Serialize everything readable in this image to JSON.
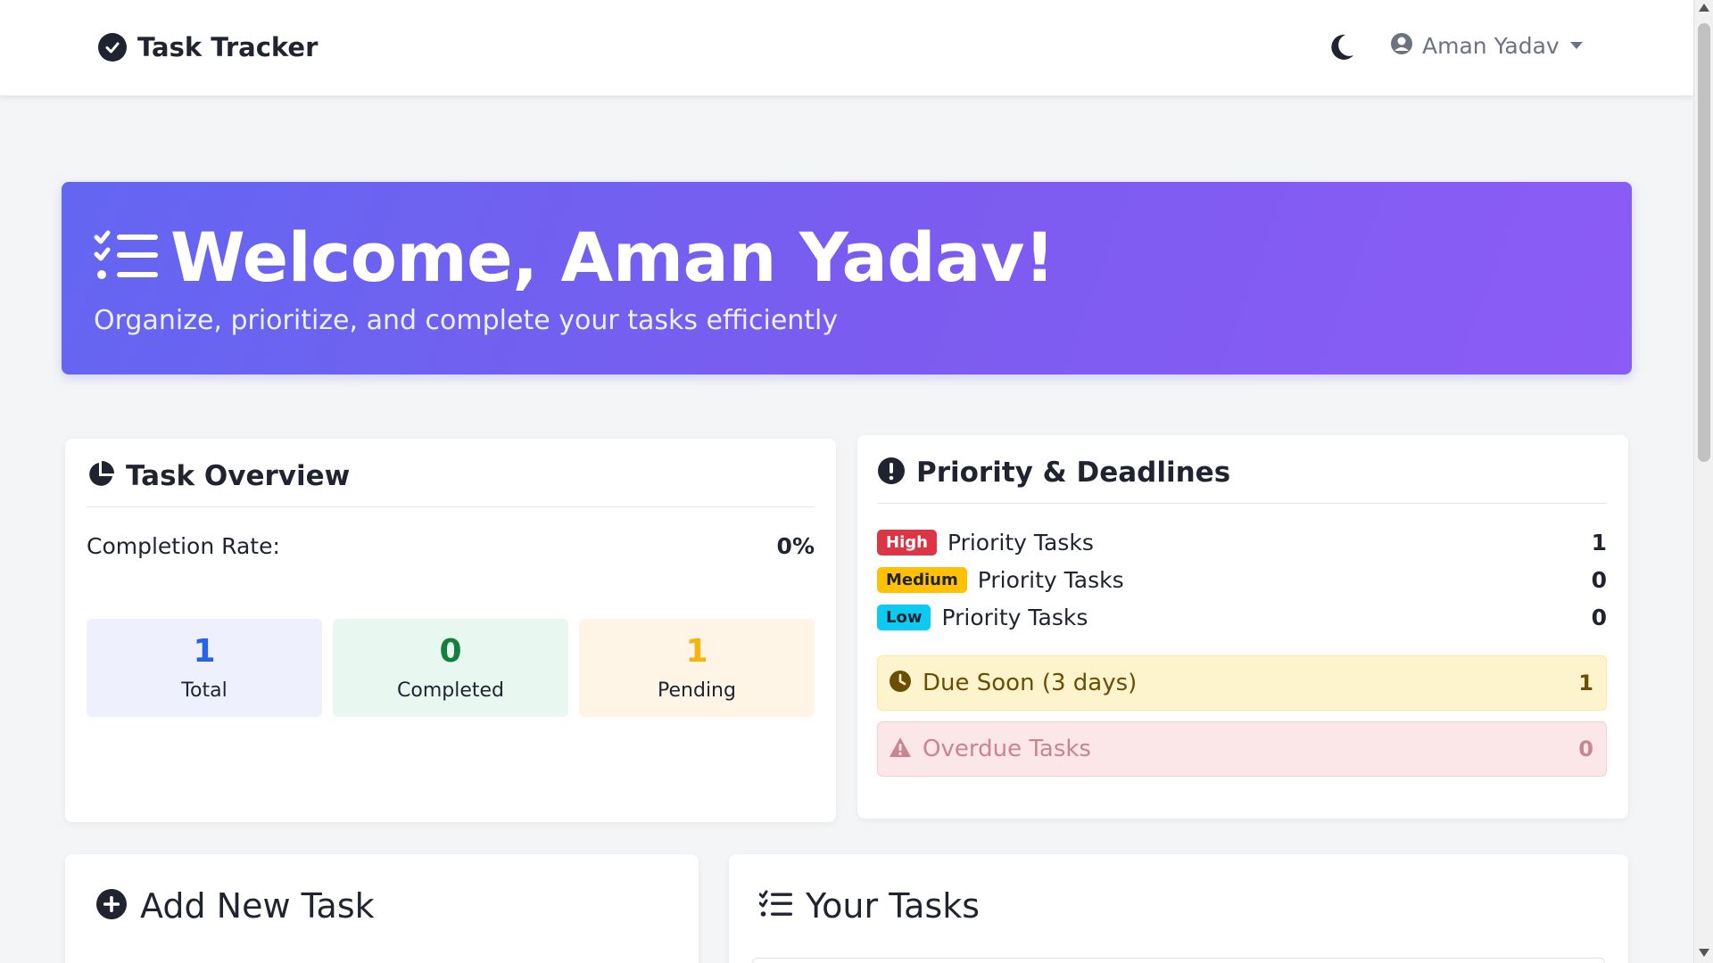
{
  "navbar": {
    "brand": "Task Tracker",
    "brand_icon": "check-circle-icon",
    "theme_icon": "moon-icon",
    "user_icon": "user-circle-icon",
    "user_name": "Aman Yadav"
  },
  "hero": {
    "icon": "task-list-icon",
    "title": "Welcome, Aman Yadav!",
    "subtitle": "Organize, prioritize, and complete your tasks efficiently"
  },
  "overview": {
    "icon": "pie-chart-icon",
    "title": "Task Overview",
    "completion_label": "Completion Rate:",
    "completion_value": "0%",
    "stats": [
      {
        "value": "1",
        "label": "Total",
        "color": "#2563eb",
        "bg": "#eef0fd"
      },
      {
        "value": "0",
        "label": "Completed",
        "color": "#15803d",
        "bg": "#e8f7ef"
      },
      {
        "value": "1",
        "label": "Pending",
        "color": "#f5b40b",
        "bg": "#fef5e7"
      }
    ]
  },
  "priority": {
    "icon": "exclamation-circle-icon",
    "title": "Priority & Deadlines",
    "rows": [
      {
        "badge": "High",
        "label": "Priority Tasks",
        "value": "1",
        "badge_bg": "#dc3545",
        "badge_fg": "#ffffff"
      },
      {
        "badge": "Medium",
        "label": "Priority Tasks",
        "value": "0",
        "badge_bg": "#ffc107",
        "badge_fg": "#1f2430"
      },
      {
        "badge": "Low",
        "label": "Priority Tasks",
        "value": "0",
        "badge_bg": "#0dcaf0",
        "badge_fg": "#1f2430"
      }
    ],
    "due_soon": {
      "icon": "clock-icon",
      "label": "Due Soon (3 days)",
      "value": "1",
      "bg": "#fdf3cd",
      "fg": "#6b4e04"
    },
    "overdue": {
      "icon": "warning-triangle-icon",
      "label": "Overdue Tasks",
      "value": "0",
      "bg": "#fbe6e8",
      "fg": "#c9868d"
    }
  },
  "add_task": {
    "icon": "plus-circle-icon",
    "title": "Add New Task"
  },
  "your_tasks": {
    "icon": "task-list-icon",
    "title": "Your Tasks"
  }
}
